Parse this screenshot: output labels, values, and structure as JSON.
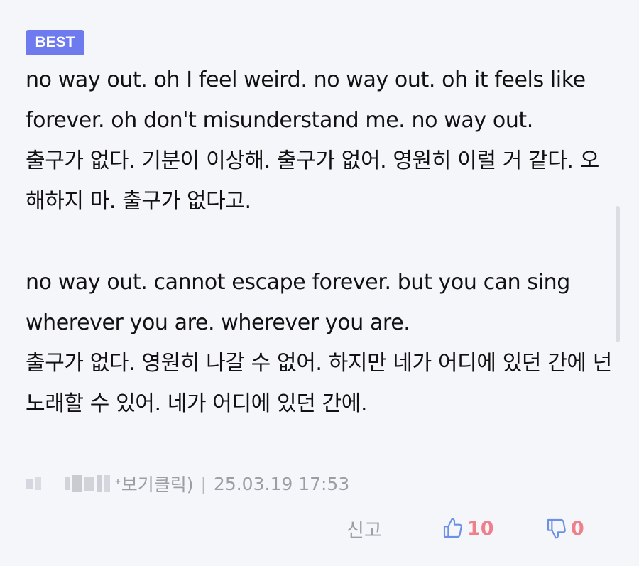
{
  "badge": "BEST",
  "comment": {
    "lines": [
      "no way out. oh I feel weird. no way out. oh it feels like forever. oh don't misunderstand me. no way out.",
      "출구가 없다. 기분이 이상해. 출구가 없어. 영원히 이럴 거 같다. 오해하지 마. 출구가 없다고.",
      "",
      "no way out. cannot escape forever. but you can sing wherever you are. wherever you are.",
      "출구가 없다. 영원히 나갈 수 없어. 하지만 네가 어디에 있던 간에 넌 노래할 수 있어. 네가 어디에 있던 간에."
    ]
  },
  "meta": {
    "author_suffix": "ᐩ보기클릭)",
    "separator": "|",
    "timestamp": "25.03.19 17:53"
  },
  "actions": {
    "report_label": "신고",
    "like_count": "10",
    "dislike_count": "0",
    "like_icon": "thumbs-up-icon",
    "dislike_icon": "thumbs-down-icon",
    "icon_color": "#6d8fe8",
    "count_color": "#f07f8c"
  },
  "colors": {
    "badge_bg": "#6d7bef",
    "background": "#f5f6fa",
    "meta_text": "#9b9ea6"
  }
}
